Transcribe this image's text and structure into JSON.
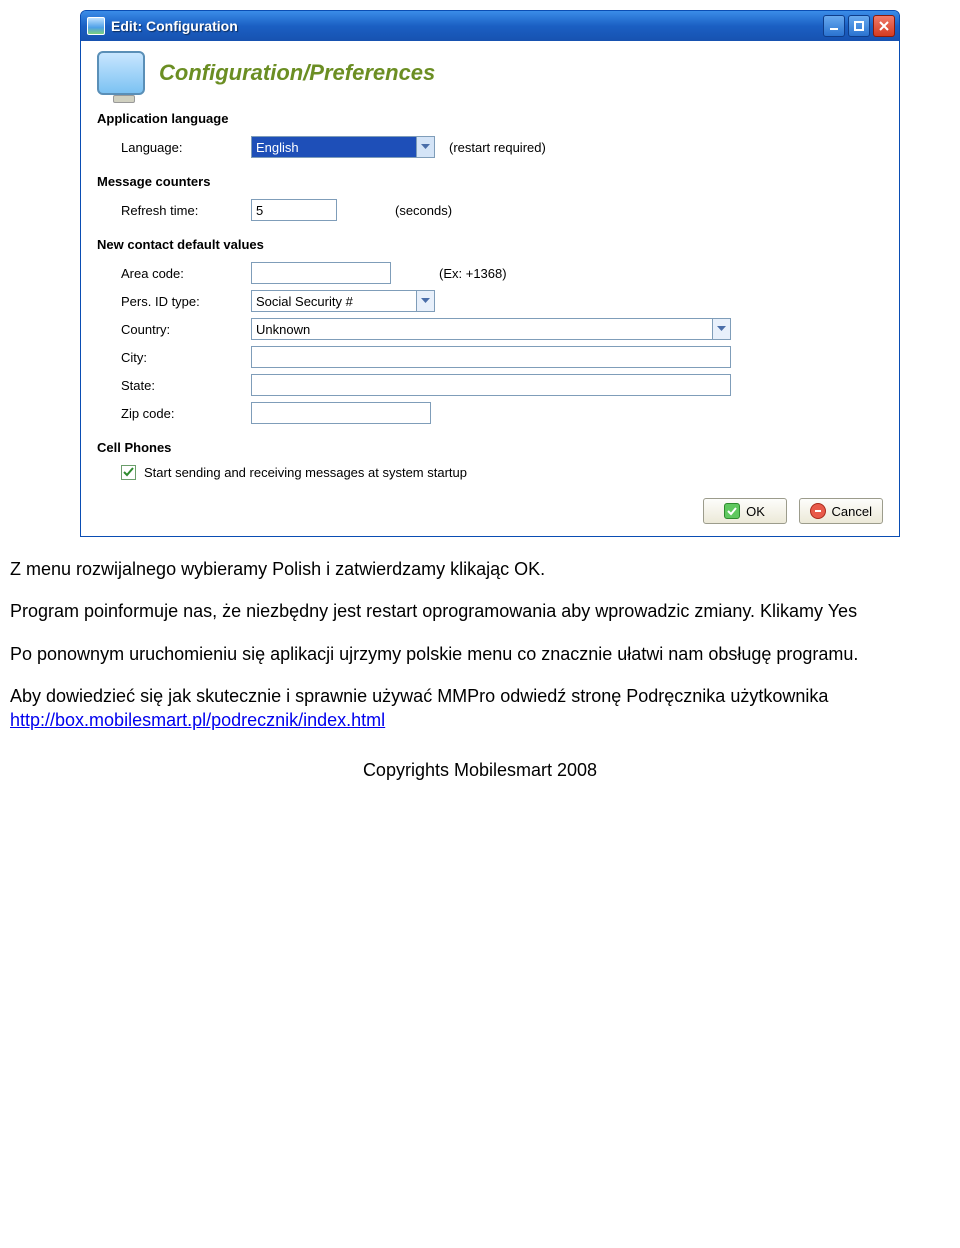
{
  "window": {
    "title": "Edit: Configuration"
  },
  "header": {
    "title": "Configuration/Preferences"
  },
  "sections": {
    "app_lang": {
      "title": "Application language"
    },
    "msg_counters": {
      "title": "Message counters"
    },
    "contact_defaults": {
      "title": "New contact default values"
    },
    "cell_phones": {
      "title": "Cell Phones"
    }
  },
  "fields": {
    "language": {
      "label": "Language:",
      "value": "English",
      "hint": "(restart required)"
    },
    "refresh": {
      "label": "Refresh time:",
      "value": "5",
      "hint": "(seconds)"
    },
    "area_code": {
      "label": "Area code:",
      "value": "",
      "hint": "(Ex: +1368)"
    },
    "pers_id": {
      "label": "Pers. ID type:",
      "value": "Social Security #"
    },
    "country": {
      "label": "Country:",
      "value": "Unknown"
    },
    "city": {
      "label": "City:",
      "value": ""
    },
    "state": {
      "label": "State:",
      "value": ""
    },
    "zip": {
      "label": "Zip code:",
      "value": ""
    }
  },
  "checkbox": {
    "startup_label": "Start sending and receiving messages at system startup",
    "checked": true
  },
  "buttons": {
    "ok": "OK",
    "cancel": "Cancel"
  },
  "doc": {
    "p1": "Z menu rozwijalnego wybieramy  Polish i zatwierdzamy klikając OK.",
    "p2": "Program poinformuje nas, że niezbędny jest restart oprogramowania aby wprowadzic zmiany. Klikamy Yes",
    "p3": "Po ponownym uruchomieniu się aplikacji ujrzymy polskie menu co znacznie ułatwi nam obsługę programu.",
    "p4_pre": " Aby dowiedzieć się jak skutecznie i sprawnie używać MMPro odwiedź stronę Podręcznika użytkownika ",
    "link_text": "http://box.mobilesmart.pl/podrecznik/index.html",
    "copyright": "Copyrights Mobilesmart 2008"
  }
}
